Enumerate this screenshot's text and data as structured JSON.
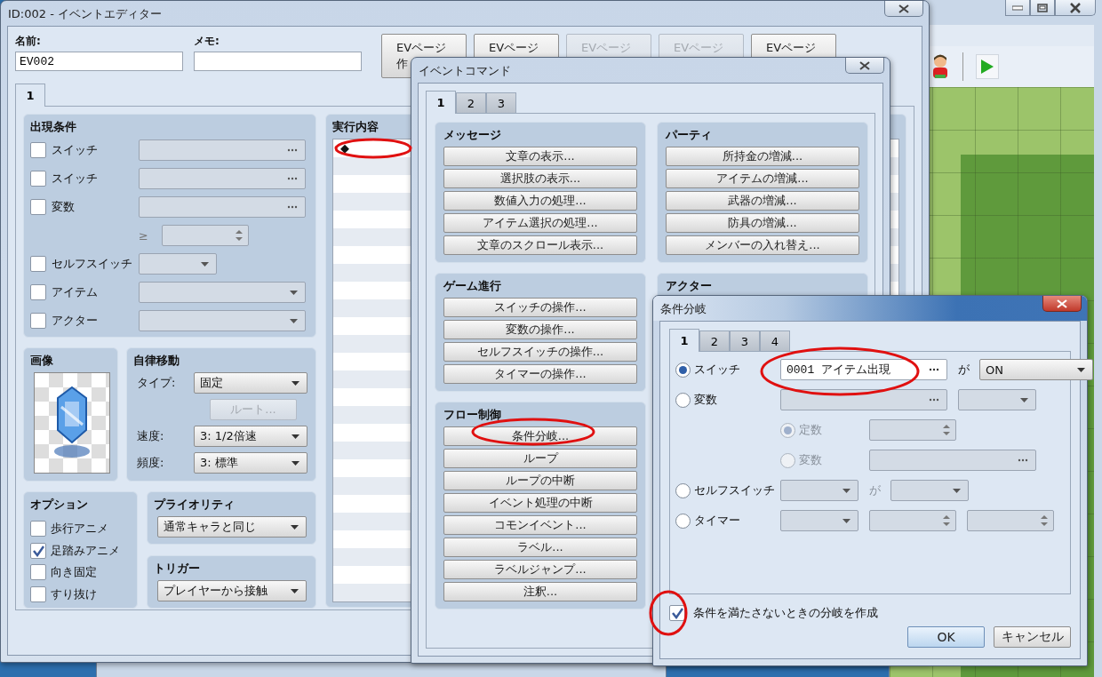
{
  "event_editor": {
    "title": "ID:002 - イベントエディター",
    "name_label": "名前:",
    "name_value": "EV002",
    "memo_label": "メモ:",
    "page_buttons": [
      {
        "lines": [
          "EVページ",
          "作"
        ],
        "disabled": false
      },
      {
        "lines": [
          "EVページ"
        ],
        "disabled": false
      },
      {
        "lines": [
          "EVページ"
        ],
        "disabled": true
      },
      {
        "lines": [
          "EVページ"
        ],
        "disabled": true
      },
      {
        "lines": [
          "EVページ"
        ],
        "disabled": false
      }
    ],
    "tabs": [
      {
        "label": "1",
        "selected": true
      }
    ],
    "conditions": {
      "title": "出現条件",
      "rows": [
        {
          "kind": "picker",
          "label": "スイッチ",
          "checked": false
        },
        {
          "kind": "picker",
          "label": "スイッチ",
          "checked": false
        },
        {
          "kind": "picker",
          "label": "変数",
          "checked": false
        },
        {
          "kind": "spin",
          "symbol": "≥"
        },
        {
          "kind": "short_select",
          "label": "セルフスイッチ",
          "checked": false
        },
        {
          "kind": "select",
          "label": "アイテム",
          "checked": false
        },
        {
          "kind": "select",
          "label": "アクター",
          "checked": false
        }
      ]
    },
    "contents": {
      "title": "実行内容",
      "lines": [
        {
          "marker": "◆"
        }
      ]
    },
    "image": {
      "title": "画像"
    },
    "movement": {
      "title": "自律移動",
      "type_label": "タイプ:",
      "type_value": "固定",
      "route_button": {
        "label": "ルート...",
        "disabled": true
      },
      "speed_label": "速度:",
      "speed_value": "3: 1/2倍速",
      "freq_label": "頻度:",
      "freq_value": "3: 標準"
    },
    "options": {
      "title": "オプション",
      "items": [
        {
          "label": "歩行アニメ",
          "checked": false
        },
        {
          "label": "足踏みアニメ",
          "checked": true
        },
        {
          "label": "向き固定",
          "checked": false
        },
        {
          "label": "すり抜け",
          "checked": false
        }
      ]
    },
    "priority": {
      "title": "プライオリティ",
      "value": "通常キャラと同じ"
    },
    "trigger": {
      "title": "トリガー",
      "value": "プレイヤーから接触"
    }
  },
  "event_command": {
    "title": "イベントコマンド",
    "tabs": [
      {
        "label": "1",
        "selected": true
      },
      {
        "label": "2",
        "selected": false
      },
      {
        "label": "3",
        "selected": false
      }
    ],
    "columns": [
      [
        {
          "title": "メッセージ",
          "buttons": [
            "文章の表示...",
            "選択肢の表示...",
            "数値入力の処理...",
            "アイテム選択の処理...",
            "文章のスクロール表示..."
          ]
        },
        {
          "title": "ゲーム進行",
          "buttons": [
            "スイッチの操作...",
            "変数の操作...",
            "セルフスイッチの操作...",
            "タイマーの操作..."
          ]
        },
        {
          "title": "フロー制御",
          "buttons": [
            "条件分岐...",
            "ループ",
            "ループの中断",
            "イベント処理の中断",
            "コモンイベント...",
            "ラベル...",
            "ラベルジャンプ...",
            "注釈..."
          ]
        }
      ],
      [
        {
          "title": "パーティ",
          "buttons": [
            "所持金の増減...",
            "アイテムの増減...",
            "武器の増減...",
            "防具の増減...",
            "メンバーの入れ替え..."
          ]
        },
        {
          "title": "アクター"
        }
      ]
    ]
  },
  "conditional_branch": {
    "title": "条件分岐",
    "tabs": [
      {
        "label": "1",
        "selected": true
      },
      {
        "label": "2",
        "selected": false
      },
      {
        "label": "3",
        "selected": false
      },
      {
        "label": "4",
        "selected": false
      }
    ],
    "rows": [
      {
        "kind": "switch",
        "label": "スイッチ",
        "selected": true,
        "value": "0001 アイテム出現",
        "joiner": "が",
        "state": "ON"
      },
      {
        "kind": "variable",
        "label": "変数",
        "selected": false,
        "sub": [
          {
            "kind": "spin",
            "label": "定数",
            "selected": true,
            "disabled": true
          },
          {
            "kind": "picker",
            "label": "変数",
            "selected": false,
            "disabled": true
          }
        ]
      },
      {
        "kind": "self_switch",
        "label": "セルフスイッチ",
        "selected": false,
        "joiner": "が"
      },
      {
        "kind": "timer",
        "label": "タイマー",
        "selected": false
      }
    ],
    "else_branch": {
      "label": "条件を満たさないときの分岐を作成",
      "checked": true
    },
    "buttons": [
      {
        "label": "OK",
        "kind": "default"
      },
      {
        "label": "キャンセル",
        "kind": "normal"
      }
    ]
  }
}
